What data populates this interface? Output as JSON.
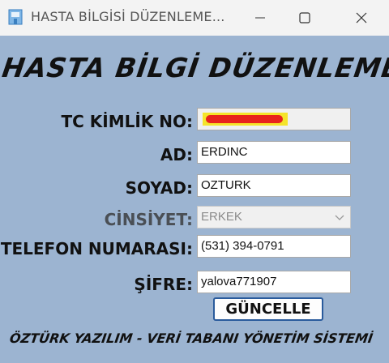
{
  "window": {
    "title": "HASTA BİLGİSİ DÜZENLEME..."
  },
  "heading": "HASTA BİLGİ DÜZENLEME PANELİ",
  "form": {
    "tc_label": "TC KİMLİK NO:",
    "tc_value": "",
    "ad_label": "AD:",
    "ad_value": "ERDINC",
    "soyad_label": "SOYAD:",
    "soyad_value": "OZTURK",
    "cinsiyet_label": "CİNSİYET:",
    "cinsiyet_value": "ERKEK",
    "telefon_label": "TELEFON NUMARASI:",
    "telefon_value": "(531) 394-0791",
    "sifre_label": "ŞİFRE:",
    "sifre_value": "yalova771907"
  },
  "button": {
    "label": "GÜNCELLE"
  },
  "footer": "ÖZTÜRK YAZILIM - VERİ TABANI YÖNETİM SİSTEMİ",
  "colors": {
    "background": "#9cb4d1",
    "titlebar": "#f3f3f3",
    "button_border": "#2a5b9c",
    "redaction": "#e8231c"
  },
  "icons": {
    "app": "hospital-icon",
    "minimize": "minimize-icon",
    "maximize": "maximize-icon",
    "close": "close-icon",
    "dropdown": "chevron-down-icon"
  }
}
